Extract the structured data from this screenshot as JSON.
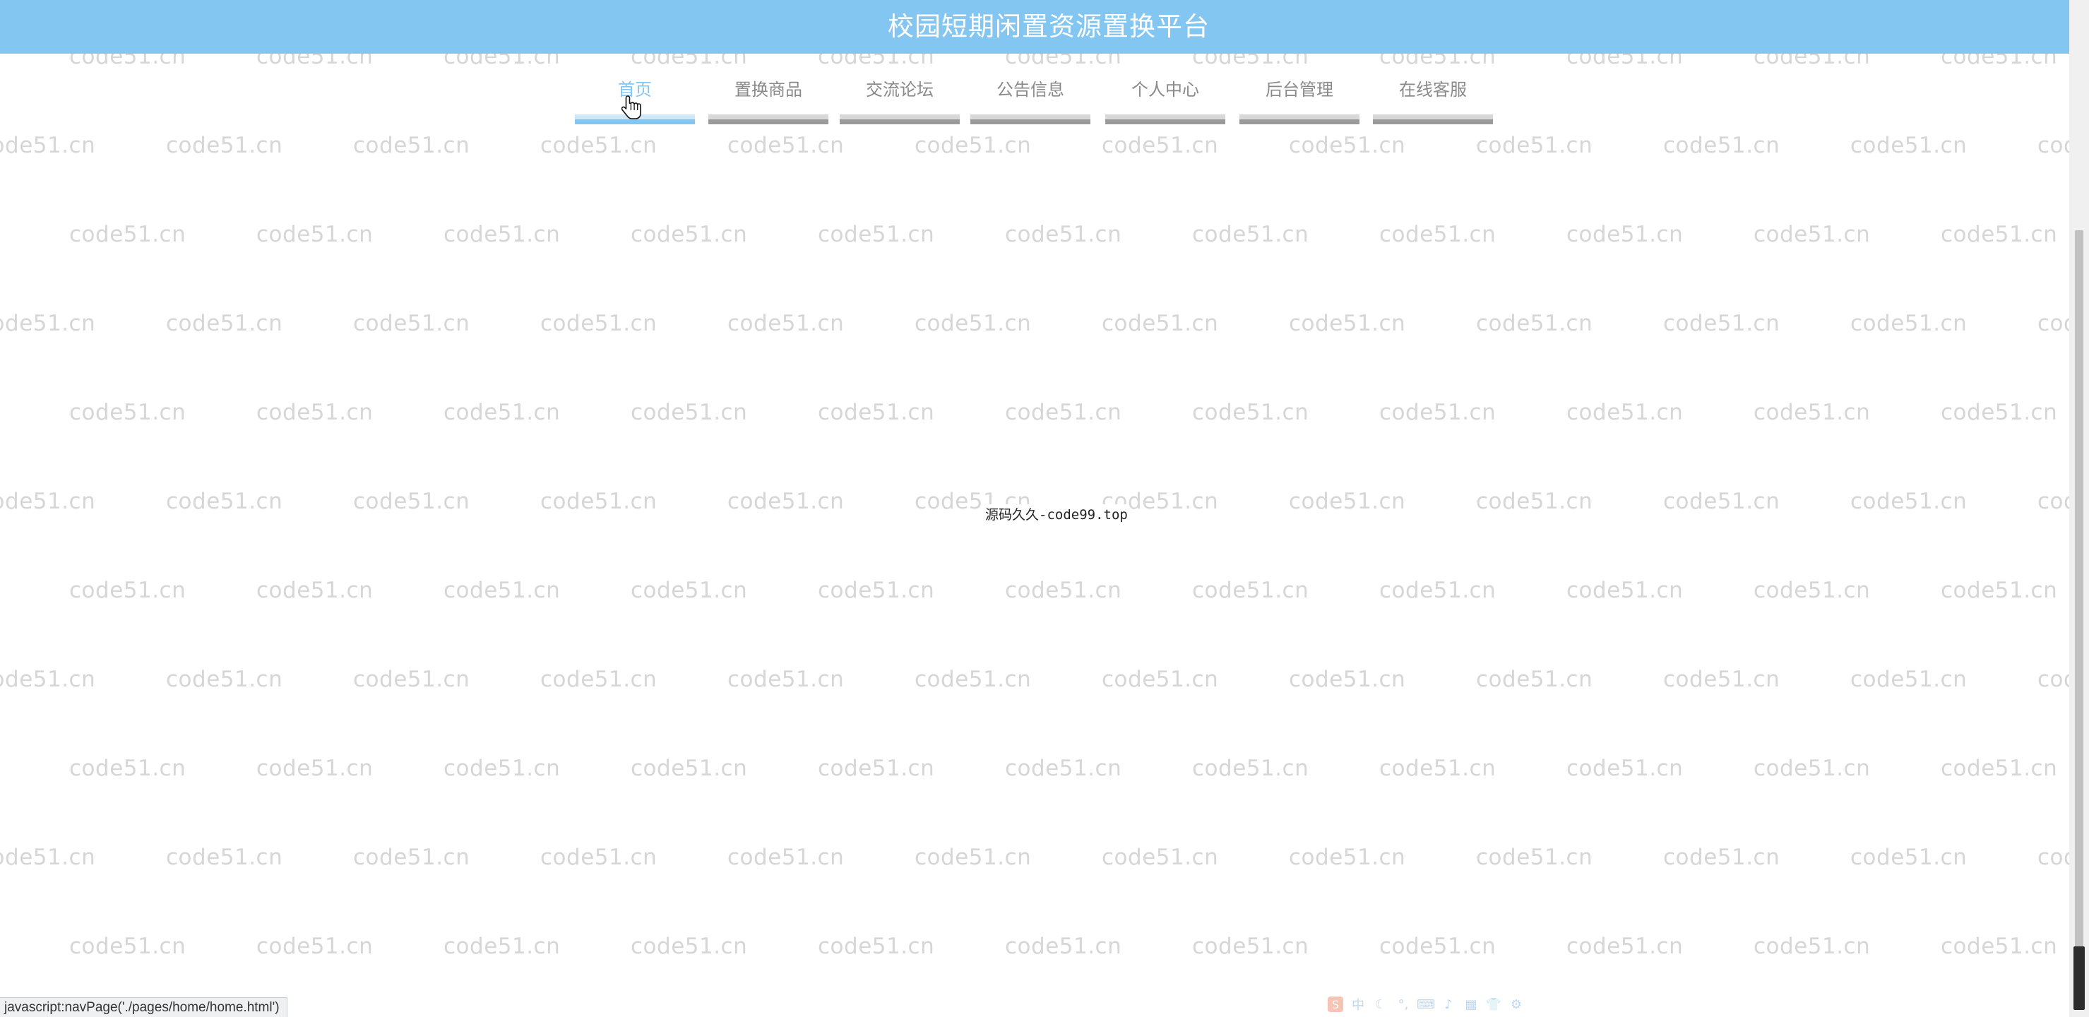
{
  "app": {
    "title": "校园短期闲置资源置换平台"
  },
  "nav": {
    "items": [
      {
        "label": "首页",
        "active": true
      },
      {
        "label": "置换商品",
        "active": false
      },
      {
        "label": "交流论坛",
        "active": false
      },
      {
        "label": "公告信息",
        "active": false
      },
      {
        "label": "个人中心",
        "active": false
      },
      {
        "label": "后台管理",
        "active": false
      },
      {
        "label": "在线客服",
        "active": false
      }
    ]
  },
  "main": {
    "center_text": "源码久久-code99.top"
  },
  "watermark": {
    "text": "code51.cn"
  },
  "status_bar": {
    "url": "javascript:navPage('./pages/home/home.html')"
  },
  "ime_toolbar": {
    "logo_icon": "sogou-logo-icon",
    "lang_label": "中",
    "icons": [
      "moon-icon",
      "punctuation-icon",
      "keyboard-icon",
      "voice-icon",
      "toolbox-icon",
      "skin-icon",
      "settings-icon"
    ]
  },
  "colors": {
    "header_bg": "#84c6f2",
    "active_nav": "#84c6f2",
    "inactive_nav_text": "#8a8a8a",
    "watermark": "#d6d6d6"
  }
}
